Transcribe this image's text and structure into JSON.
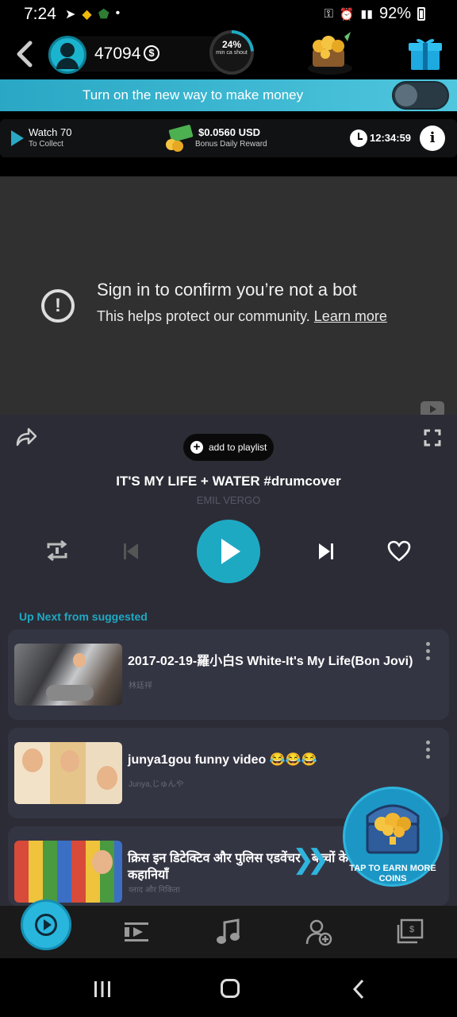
{
  "status_bar": {
    "time": "7:24",
    "battery": "92%"
  },
  "top_bar": {
    "coins": "47094",
    "currency_symbol": "$",
    "progress_percent": "24%",
    "progress_label": "min ca shout",
    "progress_value": 0.24
  },
  "banner": {
    "text": "Turn on the new way to make money",
    "toggle_on": false
  },
  "reward_bar": {
    "watch_title": "Watch 70",
    "watch_sub": "To Collect",
    "bonus_amount": "$0.0560 USD",
    "bonus_label": "Bonus Daily Reward",
    "timer": "12:34:59",
    "info": "i"
  },
  "video": {
    "title": "Sign in to confirm you’re not a bot",
    "subtitle": "This helps protect our community.",
    "link": "Learn more",
    "warn": "!"
  },
  "player": {
    "add_to_playlist": "add to playlist",
    "song_title": "IT'S MY LIFE + WATER  #drumcover",
    "artist": "EMIL VERGO",
    "up_next": "Up Next from suggested"
  },
  "up_next_items": [
    {
      "title": "2017-02-19-羅小白S White-It's My Life(Bon Jovi)",
      "channel": "林廷祥"
    },
    {
      "title": "junya1gou funny video 😂😂😂",
      "channel": "Junya,じゅんや"
    },
    {
      "title": "क्रिस इन डिटेक्टिव और पुलिस एडवेंचर - बच्चों के लिए मजेदार कहानियाँ",
      "channel": "व्लाद और निकिता"
    }
  ],
  "floating": {
    "tap_label": "TAP TO EARN MORE COINS"
  },
  "colors": {
    "accent": "#1ea9c3",
    "panel": "#2c2c36",
    "card": "#343543"
  }
}
